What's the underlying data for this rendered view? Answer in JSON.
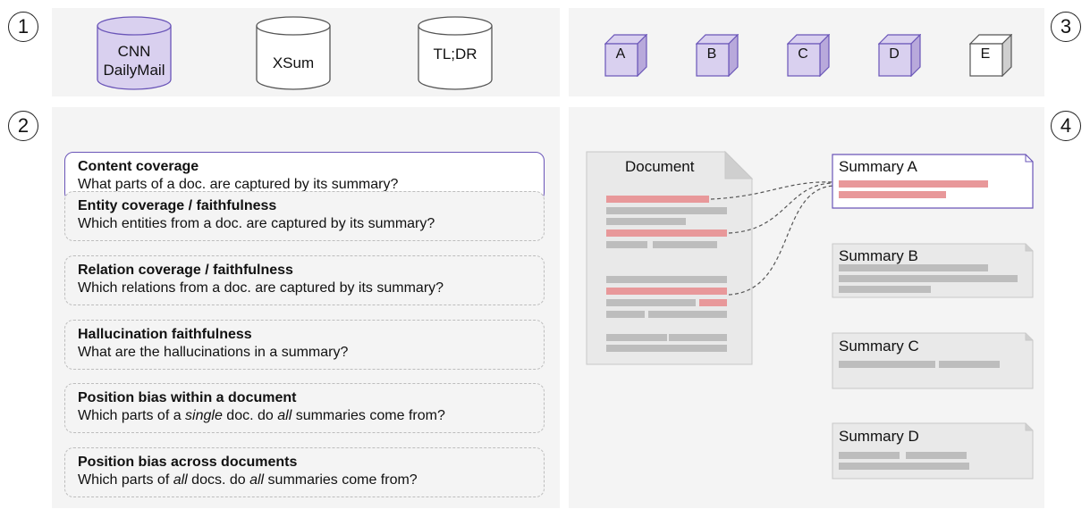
{
  "markers": [
    "1",
    "2",
    "3",
    "4"
  ],
  "datasets": [
    {
      "name": "CNN\nDailyMail",
      "highlighted": true
    },
    {
      "name": "XSum",
      "highlighted": false
    },
    {
      "name": "TL;DR",
      "highlighted": false
    }
  ],
  "models": [
    {
      "label": "A",
      "highlighted": true
    },
    {
      "label": "B",
      "highlighted": true
    },
    {
      "label": "C",
      "highlighted": true
    },
    {
      "label": "D",
      "highlighted": true
    },
    {
      "label": "E",
      "highlighted": false
    }
  ],
  "analyses": [
    {
      "title": "Content coverage",
      "desc": "What parts of a doc. are captured by its summary?",
      "active": true
    },
    {
      "title": "Entity coverage / faithfulness",
      "desc": "Which entities from a doc. are captured by its summary?",
      "active": false
    },
    {
      "title": "Relation coverage / faithfulness",
      "desc": "Which relations from a doc. are captured by its summary?",
      "active": false
    },
    {
      "title": "Hallucination faithfulness",
      "desc": "What are the hallucinations in a summary?",
      "active": false
    },
    {
      "title": "Position bias within a document",
      "desc_parts": [
        "Which parts of a ",
        "single",
        " doc. do ",
        "all",
        " summaries come from?"
      ],
      "active": false
    },
    {
      "title": "Position bias across documents",
      "desc_parts": [
        "Which parts of ",
        "all",
        " docs. do ",
        "all",
        " summaries come from?"
      ],
      "active": false
    }
  ],
  "document": {
    "title": "Document"
  },
  "summaries": [
    {
      "title": "Summary A",
      "active": true
    },
    {
      "title": "Summary B",
      "active": false
    },
    {
      "title": "Summary C",
      "active": false
    },
    {
      "title": "Summary D",
      "active": false
    }
  ],
  "colors": {
    "panel_bg": "#f4f4f4",
    "accent_purple": "#6a55b8",
    "purple_fill": "#d9d0ef",
    "highlight_red": "#e8989a",
    "text_gray": "#bdbdbd"
  }
}
